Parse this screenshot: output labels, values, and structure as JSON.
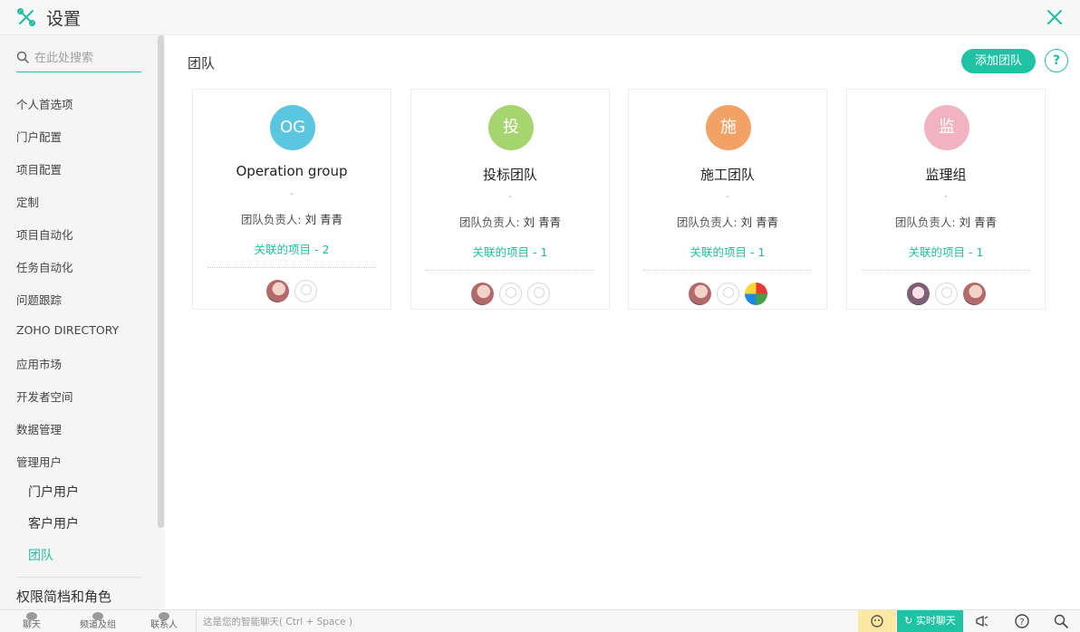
{
  "header": {
    "title": "设置"
  },
  "sidebar": {
    "search_placeholder": "在此处搜索",
    "items": [
      "个人首选项",
      "门户配置",
      "项目配置",
      "定制",
      "项目自动化",
      "任务自动化",
      "问题跟踪",
      "ZOHO DIRECTORY",
      "应用市场",
      "开发者空间",
      "数据管理",
      "管理用户"
    ],
    "subitems": [
      {
        "label": "门户用户",
        "active": false
      },
      {
        "label": "客户用户",
        "active": false
      },
      {
        "label": "团队",
        "active": true
      }
    ],
    "section": "权限简档和角色"
  },
  "main": {
    "title": "团队",
    "add_button": "添加团队",
    "help": "?",
    "teams": [
      {
        "initial": "OG",
        "color": "#5bc6df",
        "name": "Operation group",
        "desc": "-",
        "owner_label": "团队负责人:",
        "owner": "刘 青青",
        "projects": "关联的项目 - 2",
        "members": [
          "photo-a",
          "default"
        ]
      },
      {
        "initial": "投",
        "color": "#a6d46f",
        "name": "投标团队",
        "desc": "-",
        "owner_label": "团队负责人:",
        "owner": "刘 青青",
        "projects": "关联的项目 - 1",
        "members": [
          "photo-a",
          "default",
          "default"
        ]
      },
      {
        "initial": "施",
        "color": "#f3a265",
        "name": "施工团队",
        "desc": "-",
        "owner_label": "团队负责人:",
        "owner": "刘 青青",
        "projects": "关联的项目 - 1",
        "members": [
          "photo-a",
          "default",
          "logo"
        ]
      },
      {
        "initial": "监",
        "color": "#f1b3c0",
        "name": "监理组",
        "desc": "-",
        "owner_label": "团队负责人:",
        "owner": "刘 青青",
        "projects": "关联的项目 - 1",
        "members": [
          "photo-b",
          "default",
          "photo-a"
        ]
      }
    ]
  },
  "bottom_bar": {
    "tabs": [
      "聊天",
      "频道及组",
      "联系人"
    ],
    "chat_placeholder": "这是您的智能聊天( Ctrl + Space )",
    "live_chat": "实时聊天"
  }
}
